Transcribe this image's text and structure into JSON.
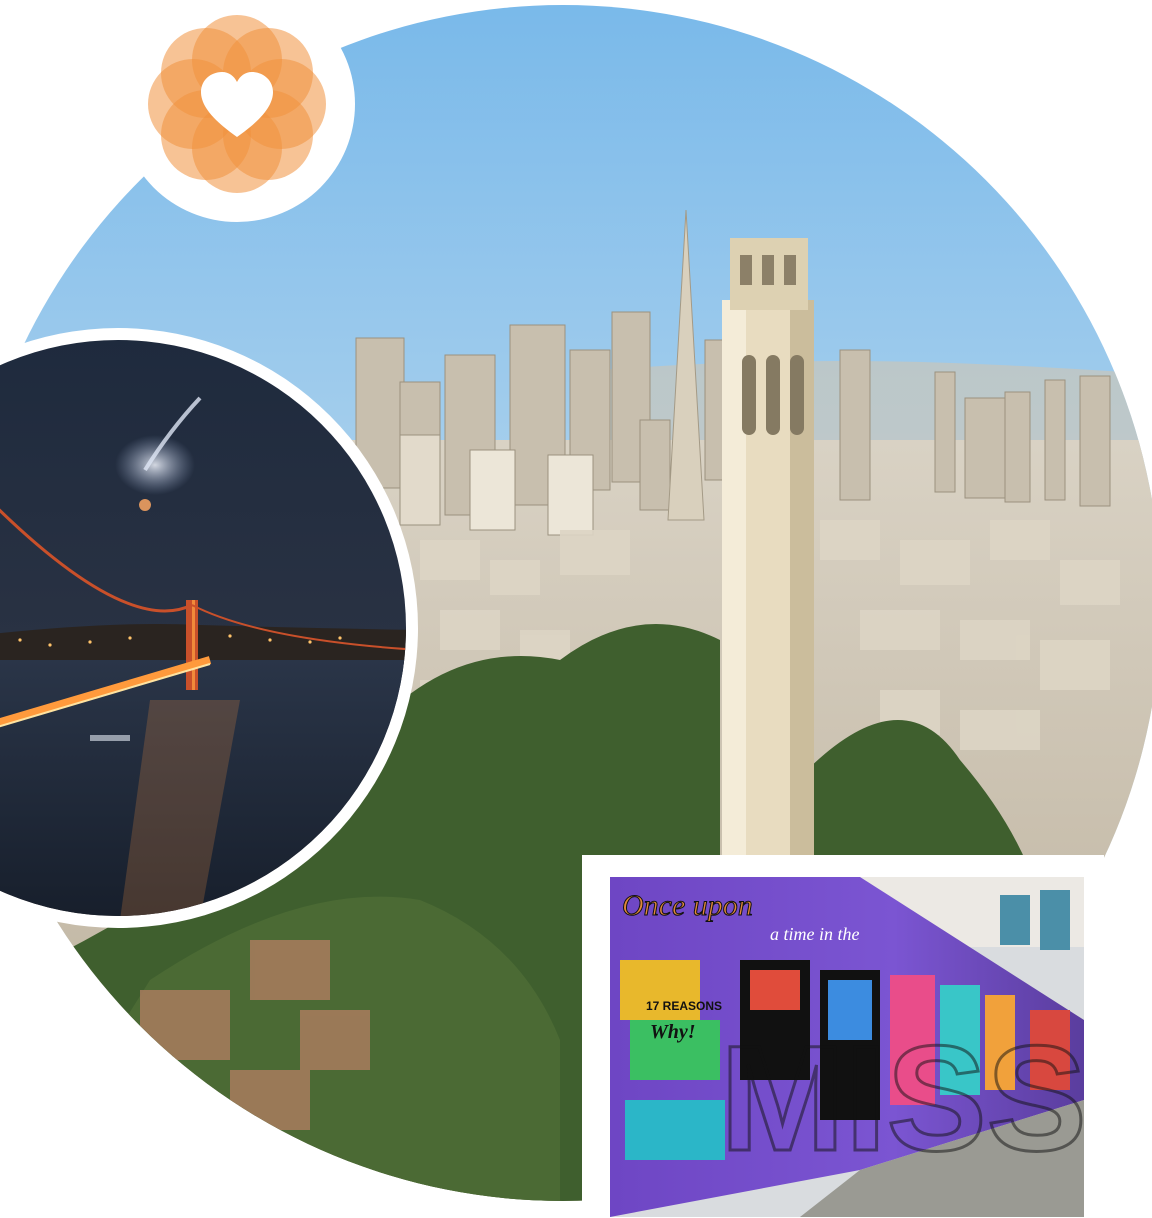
{
  "collage": {
    "badge": {
      "icon": "heart-icon",
      "color": "#f0923e"
    },
    "photos": [
      {
        "name": "coit-tower-aerial-photo",
        "subject": "aerial"
      },
      {
        "name": "golden-gate-night-photo",
        "subject": "bridge"
      },
      {
        "name": "mission-mural-photo",
        "subject": "mural"
      }
    ],
    "mural_text": {
      "line1": "Once upon",
      "line2": "a time in the",
      "word": "MISSION",
      "badge": "17 REASONS",
      "badge2": "Why!"
    }
  }
}
